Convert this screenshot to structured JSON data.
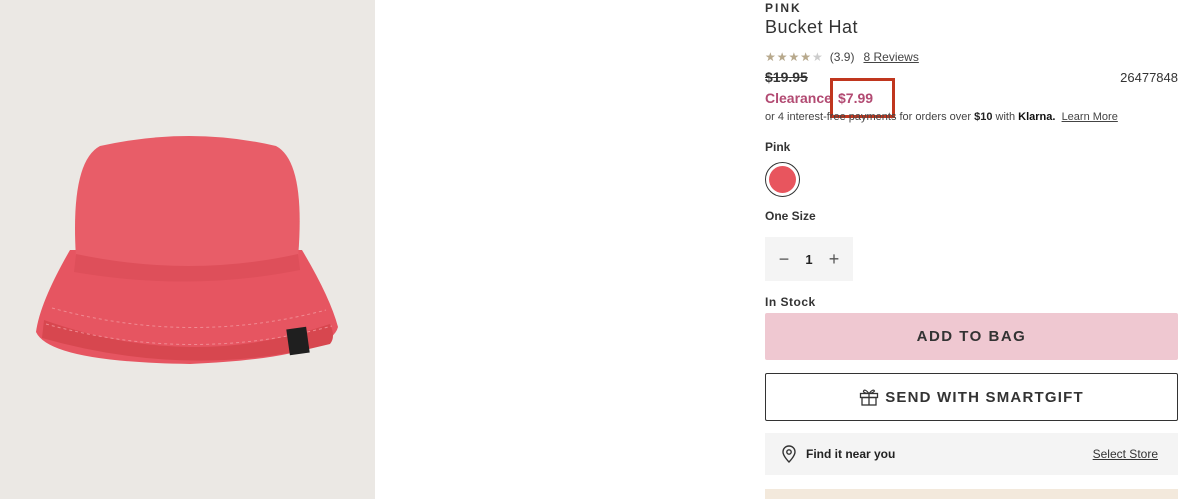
{
  "product": {
    "brand": "PINK",
    "name": "Bucket Hat",
    "rating": "(3.9)",
    "rating_value": 3.9,
    "rating_max": 5,
    "reviews_link": "8 Reviews",
    "original_price": "$19.95",
    "sku": "26477848",
    "clearance_label": "Clearance",
    "sale_price": "$7.99"
  },
  "klarna": {
    "prefix": "or 4 interest-free payments for orders over ",
    "threshold": "$10",
    "with": " with ",
    "logo": "Klarna.",
    "learn_more": "Learn More"
  },
  "color": {
    "label": "Pink",
    "swatch_hex": "#e8555e"
  },
  "size": {
    "label": "One Size"
  },
  "quantity": {
    "minus": "−",
    "value": "1",
    "plus": "+"
  },
  "stock_status": "In Stock",
  "actions": {
    "add_to_bag": "ADD TO BAG",
    "smartgift": "SEND WITH SMARTGIFT"
  },
  "store": {
    "find_label": "Find it near you",
    "select_label": "Select Store"
  },
  "colors": {
    "sale": "#b24a72",
    "add_to_bag_bg": "#efc8d1",
    "image_bg": "#ebe8e4",
    "highlight": "#c0361e"
  }
}
